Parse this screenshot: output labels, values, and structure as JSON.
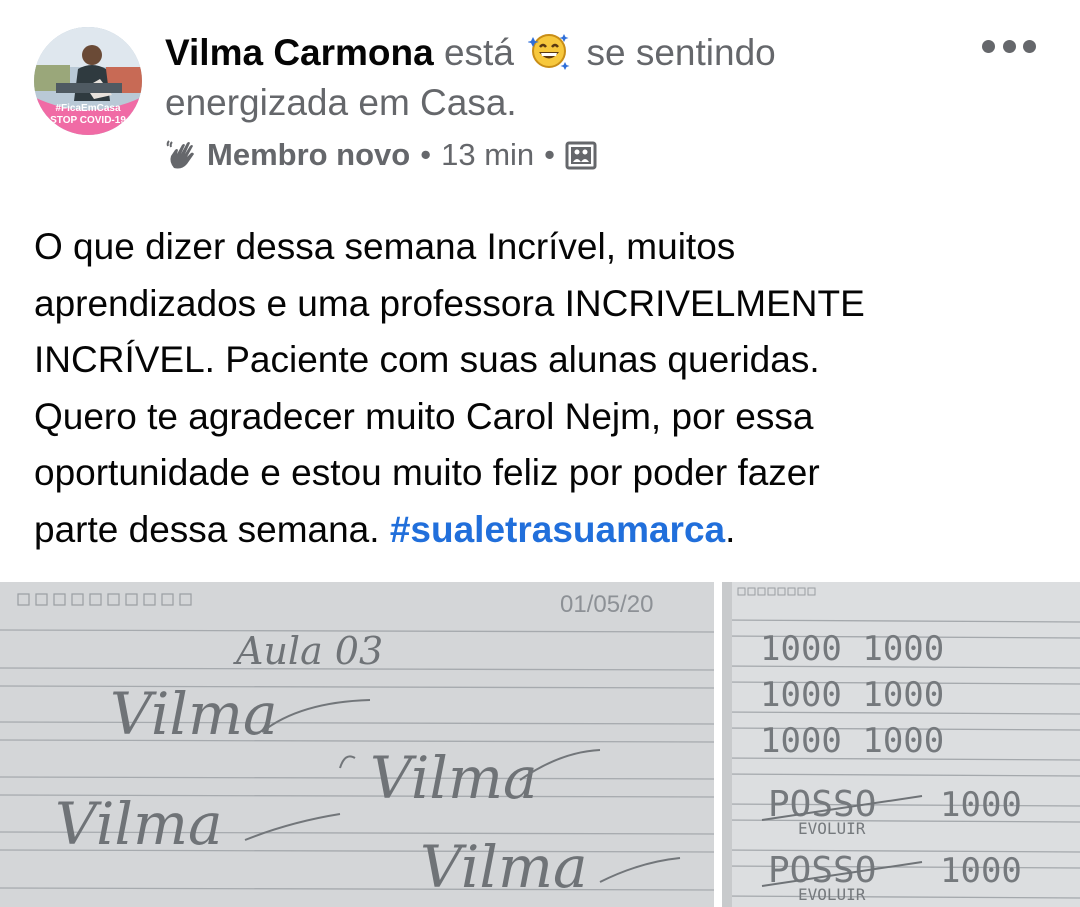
{
  "post": {
    "author": "Vilma Carmona",
    "verb": "está",
    "feeling_prefix": "se sentindo",
    "feeling": "energizada em Casa.",
    "badge": "Membro novo",
    "separator": "•",
    "time": "13 min",
    "body_lines": [
      "O que dizer dessa semana Incrível, muitos",
      "aprendizados e uma professora INCRIVELMENTE",
      "INCRÍVEL. Paciente com suas alunas queridas.",
      "Quero te agradecer muito Carol Nejm, por essa",
      "oportunidade e estou muito feliz por poder fazer",
      "parte dessa semana."
    ],
    "hashtag": "#sualetrasuamarca",
    "trailing": "."
  },
  "avatar": {
    "frame_line1": "#FicaEmCasa",
    "frame_line2": "STOP COVID-19",
    "frame_color": "#f06ba5"
  },
  "photo_left": {
    "date": "01/05/20",
    "heading": "Aula 03",
    "words": [
      "Vilma",
      "Vilma",
      "Vilma",
      "Vilma"
    ]
  },
  "photo_right": {
    "rows": [
      "1000  1000",
      "1000  1000",
      "1000  1000"
    ],
    "posso_rows": [
      {
        "top": "POSSO",
        "sub": "EVOLUIR",
        "num": "1000"
      },
      {
        "top": "POSSO",
        "sub": "EVOLUIR",
        "num": "1000"
      }
    ]
  },
  "colors": {
    "secondary_text": "#65676b",
    "hashtag": "#216fdb",
    "paper": "#d4d6d8"
  },
  "icons": [
    "avatar",
    "grinning-emoji-icon",
    "waving-hand-icon",
    "more-options-icon",
    "photo-album-icon"
  ]
}
